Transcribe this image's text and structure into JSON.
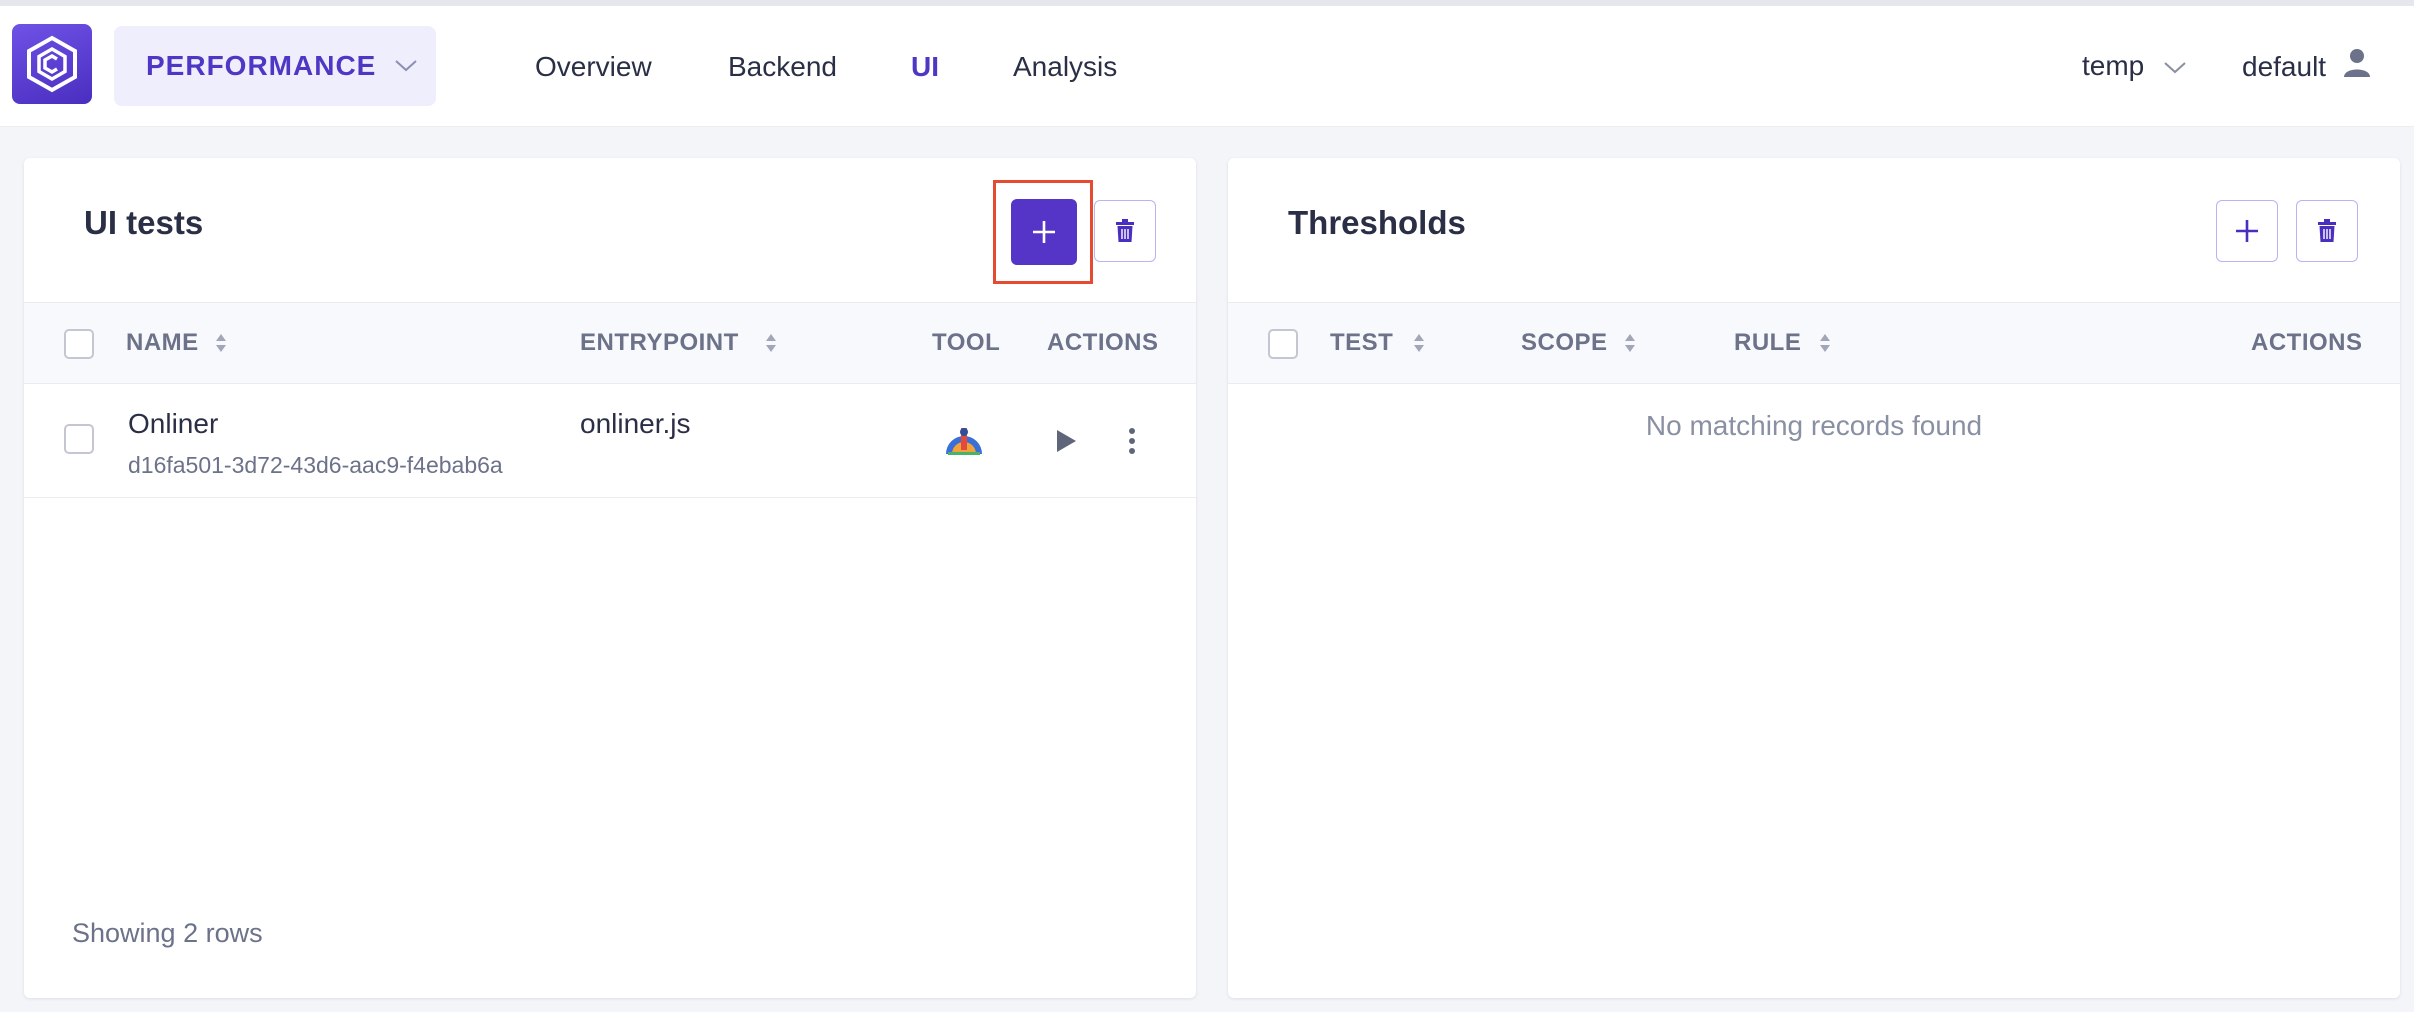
{
  "header": {
    "project_label": "PERFORMANCE",
    "nav": [
      {
        "label": "Overview",
        "active": false
      },
      {
        "label": "Backend",
        "active": false
      },
      {
        "label": "UI",
        "active": true
      },
      {
        "label": "Analysis",
        "active": false
      }
    ],
    "env_select": "temp",
    "user": "default"
  },
  "ui_tests": {
    "title": "UI tests",
    "columns": [
      "NAME",
      "ENTRYPOINT",
      "TOOL",
      "ACTIONS"
    ],
    "rows": [
      {
        "name": "Onliner",
        "id": "d16fa501-3d72-43d6-aac9-f4ebab6a",
        "entrypoint": "onliner.js",
        "tool_icon": "sitespeed-icon"
      }
    ],
    "footer": "Showing 2 rows"
  },
  "thresholds": {
    "title": "Thresholds",
    "columns": [
      "TEST",
      "SCOPE",
      "RULE",
      "ACTIONS"
    ],
    "empty": "No matching records found"
  },
  "colors": {
    "accent": "#5535c8",
    "highlight": "#e54a32"
  }
}
